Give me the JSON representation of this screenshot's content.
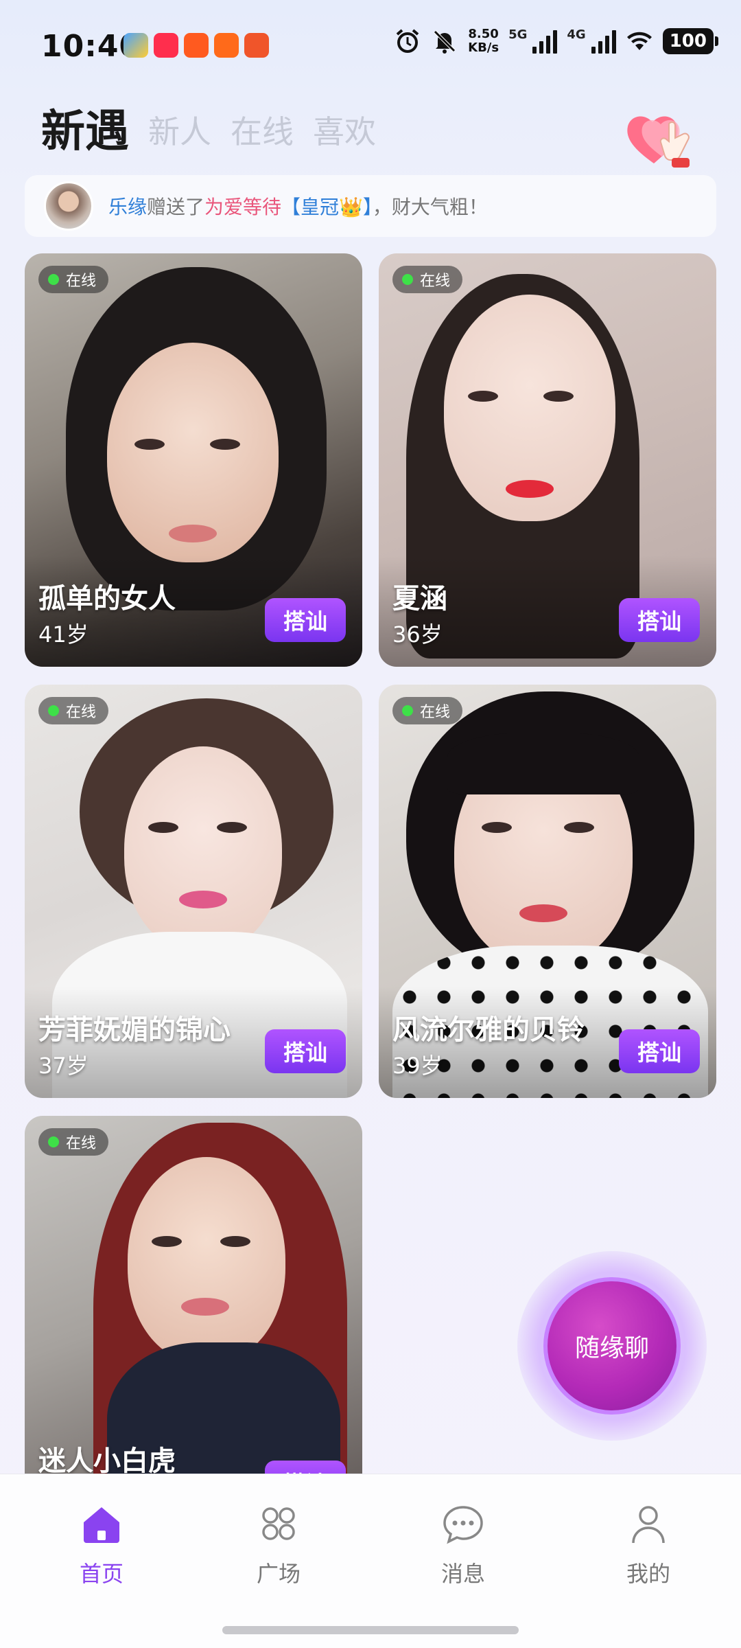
{
  "status_bar": {
    "time": "10:40",
    "net_speed": "8.50",
    "net_unit": "KB/s",
    "signal1": "5G",
    "signal2": "4G",
    "battery": "100"
  },
  "header": {
    "tabs": [
      {
        "label": "新遇",
        "active": true
      },
      {
        "label": "新人",
        "active": false
      },
      {
        "label": "在线",
        "active": false
      },
      {
        "label": "喜欢",
        "active": false
      }
    ]
  },
  "banner": {
    "sender": "乐缘",
    "verb": "赠送了",
    "receiver": "为爱等待",
    "gift": "【皇冠👑】",
    "suffix": "，财大气粗！"
  },
  "cards": [
    {
      "status": "在线",
      "name": "孤单的女人",
      "age": "41岁",
      "action": "搭讪"
    },
    {
      "status": "在线",
      "name": "夏涵",
      "age": "36岁",
      "action": "搭讪"
    },
    {
      "status": "在线",
      "name": "芳菲妩媚的锦心",
      "age": "37岁",
      "action": "搭讪"
    },
    {
      "status": "在线",
      "name": "风流尔雅的贝铃",
      "age": "39岁",
      "action": "搭讪"
    },
    {
      "status": "在线",
      "name": "迷人小白虎",
      "age": "",
      "action": "搭讪"
    }
  ],
  "float_button": {
    "label": "随缘聊"
  },
  "nav": [
    {
      "label": "首页",
      "icon": "home-icon",
      "active": true
    },
    {
      "label": "广场",
      "icon": "square-grid-icon",
      "active": false
    },
    {
      "label": "消息",
      "icon": "message-icon",
      "active": false
    },
    {
      "label": "我的",
      "icon": "profile-icon",
      "active": false
    }
  ],
  "colors": {
    "accent": "#8a43f0",
    "online": "#3ee048",
    "button": "#9a46f8"
  }
}
